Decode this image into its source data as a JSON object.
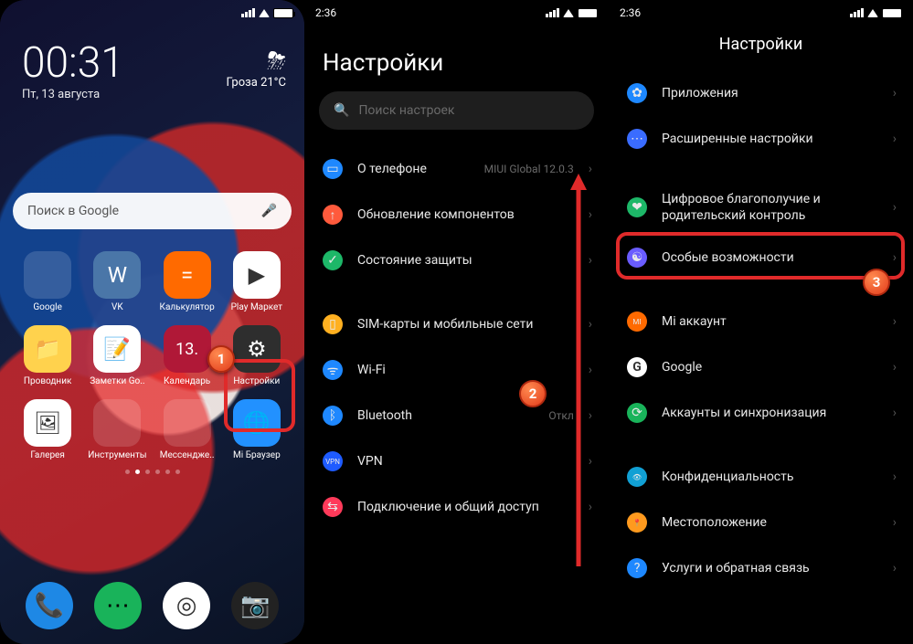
{
  "panel1": {
    "status": {
      "time": ""
    },
    "clock": {
      "time": "00:31",
      "date": "Пт, 13 августа"
    },
    "weather": {
      "desc": "Гроза",
      "temp": "21°C"
    },
    "search": {
      "placeholder": "Поиск в Google"
    },
    "apps": [
      {
        "name": "google",
        "label": "Google",
        "bg": "folder",
        "folder": true
      },
      {
        "name": "vk",
        "label": "VK",
        "bg": "#4a76a8",
        "glyph": "W"
      },
      {
        "name": "calculator",
        "label": "Калькулятор",
        "bg": "#ff6a00",
        "glyph": "="
      },
      {
        "name": "play",
        "label": "Play Маркет",
        "bg": "#fff",
        "glyph": "▶"
      },
      {
        "name": "explorer",
        "label": "Проводник",
        "bg": "#ffd24d",
        "glyph": "📁"
      },
      {
        "name": "notes",
        "label": "Заметки Go..",
        "bg": "#fff",
        "glyph": "📝"
      },
      {
        "name": "calendar",
        "label": "Календарь",
        "bg": "#b01837",
        "glyph": "13"
      },
      {
        "name": "settings",
        "label": "Настройки",
        "bg": "#2e2e2e",
        "glyph": "⚙"
      },
      {
        "name": "gallery",
        "label": "Галерея",
        "bg": "#fff",
        "glyph": "🖼"
      },
      {
        "name": "tools",
        "label": "Инструменты",
        "bg": "folder",
        "folder": true
      },
      {
        "name": "messengers",
        "label": "Мессендже..",
        "bg": "folder",
        "folder": true
      },
      {
        "name": "browser",
        "label": "Mi Браузер",
        "bg": "#2291ff",
        "glyph": "🌐"
      }
    ],
    "dock": [
      {
        "name": "phone",
        "bg": "#1e88e5",
        "glyph": "📞"
      },
      {
        "name": "messages",
        "bg": "#19b35a",
        "glyph": "⋯"
      },
      {
        "name": "chrome",
        "bg": "#fff",
        "glyph": "◎"
      },
      {
        "name": "camera",
        "bg": "#222",
        "glyph": "📷"
      }
    ]
  },
  "panel2": {
    "status_time": "2:36",
    "title": "Настройки",
    "search_placeholder": "Поиск настроек",
    "items": [
      {
        "name": "about",
        "label": "О телефоне",
        "value": "MIUI Global 12.0.3",
        "bg": "#1e88ff",
        "glyph": "▭"
      },
      {
        "name": "updates",
        "label": "Обновление компонентов",
        "bg": "#ff5a3c",
        "glyph": "↑"
      },
      {
        "name": "security",
        "label": "Состояние защиты",
        "bg": "#1db768",
        "glyph": "✓"
      },
      {
        "gap": true
      },
      {
        "name": "sim",
        "label": "SIM-карты и мобильные сети",
        "bg": "#ffb020",
        "glyph": "▯"
      },
      {
        "name": "wifi",
        "label": "Wi-Fi",
        "value_blur": true,
        "value": "        ",
        "bg": "#1e88ff",
        "glyph": "ᯤ"
      },
      {
        "name": "bluetooth",
        "label": "Bluetooth",
        "value": "Откл",
        "bg": "#1e88ff",
        "glyph": "ᛒ"
      },
      {
        "name": "vpn",
        "label": "VPN",
        "bg": "#1e5bff",
        "glyph": "VPN"
      },
      {
        "name": "tether",
        "label": "Подключение и общий доступ",
        "bg": "#ff3a5a",
        "glyph": "⇆"
      }
    ]
  },
  "panel3": {
    "status_time": "2:36",
    "title": "Настройки",
    "items": [
      {
        "name": "apps",
        "label": "Приложения",
        "bg": "#1e88ff",
        "glyph": "✿"
      },
      {
        "name": "advanced",
        "label": "Расширенные настройки",
        "bg": "#3a6cff",
        "glyph": "⋯"
      },
      {
        "gap": true
      },
      {
        "name": "wellbeing",
        "label": "Цифровое благополучие и родительский контроль",
        "bg": "#1db768",
        "glyph": "❤"
      },
      {
        "name": "accessibility",
        "label": "Особые возможности",
        "bg": "#6a5cff",
        "glyph": "☯"
      },
      {
        "gap": true
      },
      {
        "name": "mi-account",
        "label": "Mi аккаунт",
        "value_blur": true,
        "value": "      ",
        "bg": "#ff6a00",
        "glyph": "MI"
      },
      {
        "name": "google",
        "label": "Google",
        "bg": "#fff",
        "glyph": "G"
      },
      {
        "name": "sync",
        "label": "Аккаунты и синхронизация",
        "bg": "#19b35a",
        "glyph": "⟳"
      },
      {
        "gap": true
      },
      {
        "name": "privacy",
        "label": "Конфиденциальность",
        "bg": "#11a0d4",
        "glyph": "👁"
      },
      {
        "name": "location",
        "label": "Местоположение",
        "bg": "#ff9a1e",
        "glyph": "📍"
      },
      {
        "name": "feedback",
        "label": "Услуги и обратная связь",
        "bg": "#1e88ff",
        "glyph": "?"
      }
    ]
  },
  "badges": {
    "b1": "1",
    "b2": "2",
    "b3": "3"
  }
}
